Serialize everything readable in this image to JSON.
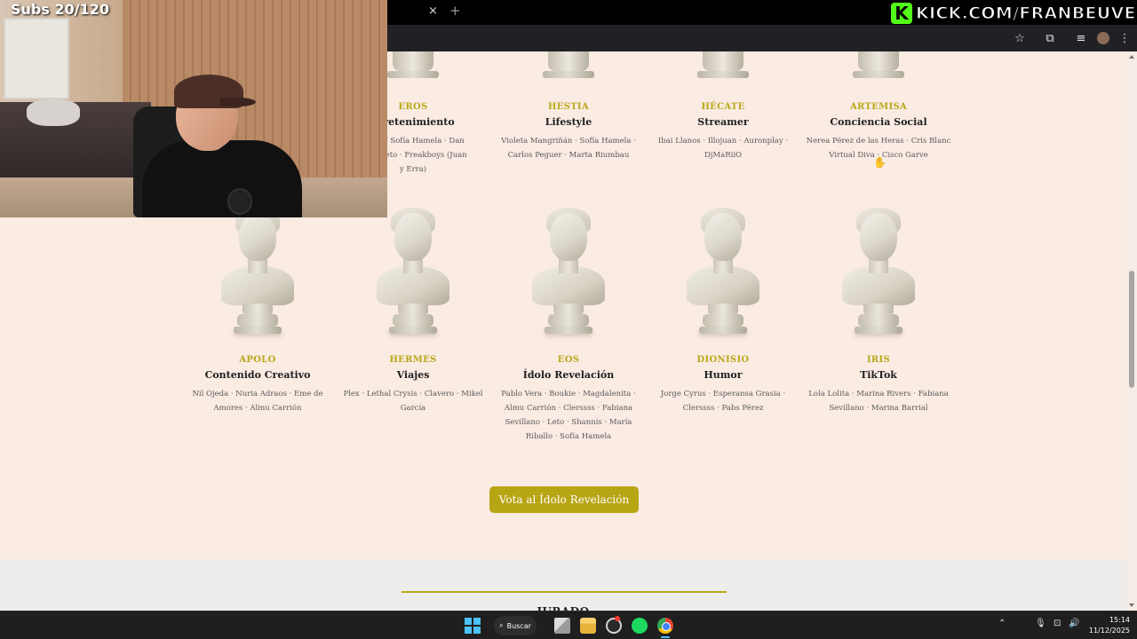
{
  "browser": {
    "tab_close": "×",
    "tab_new": "+",
    "toolbar_icons": [
      "star-icon",
      "extensions-icon",
      "media-icon",
      "profile-avatar",
      "menu-icon"
    ],
    "star_glyph": "☆",
    "extensions_glyph": "⧉",
    "media_glyph": "≡",
    "menu_glyph": "⋮"
  },
  "stream": {
    "kick_logo": "K",
    "kick_url": "KICK.COM/FRANBEUVE",
    "subs_counter": "Subs 20/120"
  },
  "top_row": [
    {
      "name": "EROS",
      "category": "ntretenimiento",
      "nominees": [
        "añón Y Sofía Hamela · Dan",
        "nereisleto · Freakboys (Juan",
        "y Erra)"
      ]
    },
    {
      "name": "HESTIA",
      "category": "Lifestyle",
      "nominees": [
        "Violeta Mangriñán · Sofía Hamela ·",
        "Carlos Peguer · Marta Riumbau"
      ]
    },
    {
      "name": "HÉCATE",
      "category": "Streamer",
      "nominees": [
        "Ibai Llanos · Illojuan · Auronplay ·",
        "DjMaRiiO"
      ]
    },
    {
      "name": "ARTEMISA",
      "category": "Conciencia Social",
      "nominees": [
        "Nerea Pérez de las Heras · Cris Blanc",
        "Virtual Diva · Cisco Garve"
      ]
    }
  ],
  "bottom_row": [
    {
      "name": "APOLO",
      "category": "Contenido Creativo",
      "nominees": [
        "Nil Ojeda · Nuria Adraos · Eme de",
        "Amores · Almu Carrión"
      ]
    },
    {
      "name": "HERMES",
      "category": "Viajes",
      "nominees": [
        "Plex · Lethal Crysis · Clavero · Mikel",
        "García"
      ]
    },
    {
      "name": "EOS",
      "category": "Ídolo Revelación",
      "nominees": [
        "Pablo Vera · Boukie · Magdalenita ·",
        "Almu Carrión · Clerssss · Fabiana",
        "Sevillano · Leto · Shannis · María",
        "Riballo · Sofía Hamela"
      ]
    },
    {
      "name": "DIONISIO",
      "category": "Humor",
      "nominees": [
        "Jorge Cyrus · Esperansa Grasia ·",
        "Clerssss · Pabs Pérez"
      ]
    },
    {
      "name": "IRIS",
      "category": "TikTok",
      "nominees": [
        "Lola Lolita · Marina Rivers · Fabiana",
        "Sevillano · Marina Barrial"
      ]
    }
  ],
  "vote_button": "Vota al Ídolo Revelación",
  "jurado_title": "JURADO",
  "cursor_glyph": "✋",
  "taskbar": {
    "search_label": "Buscar",
    "search_glyph": "⌕",
    "tray_chevron": "⌃",
    "tray_mic": "🎙",
    "tray_network": "⊡",
    "tray_volume": "🔊",
    "time": "15:14",
    "date": "11/12/2025"
  },
  "colors": {
    "accent": "#b9a81a",
    "page_bg": "#faebe3",
    "button": "#b8a514"
  }
}
